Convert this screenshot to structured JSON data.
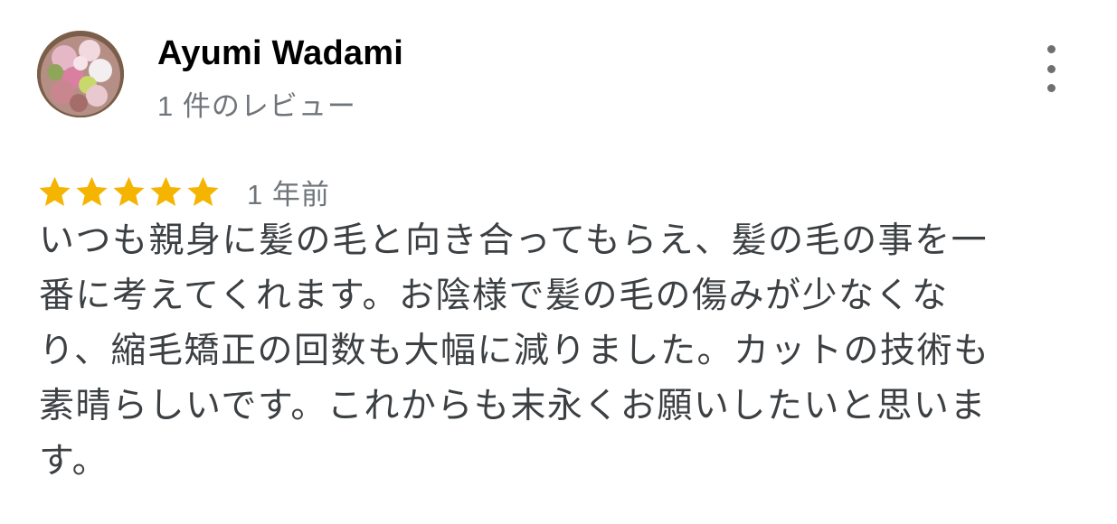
{
  "review": {
    "reviewer_name": "Ayumi Wadami",
    "reviewer_meta": "1 件のレビュー",
    "rating": 5,
    "rating_max": 5,
    "star_color": "#f4b400",
    "date": "1 年前",
    "text": "いつも親身に髪の毛と向き合ってもらえ、髪の毛の事を一番に考えてくれます。お陰様で髪の毛の傷みが少なくなり、縮毛矯正の回数も大幅に減りました。カットの技術も素晴らしいです。これからも末永くお願いしたいと思います。"
  },
  "icons": {
    "avatar": "flower-bouquet-avatar",
    "more": "more-vert-icon",
    "star": "star-icon"
  }
}
